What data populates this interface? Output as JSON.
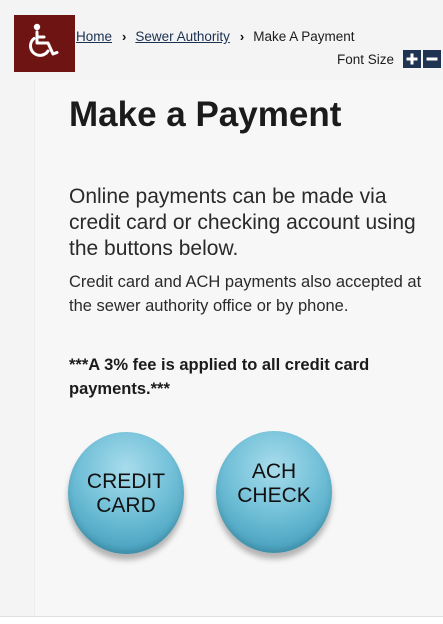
{
  "breadcrumb": {
    "home": "Home",
    "section": "Sewer Authority",
    "current": "Make A Payment",
    "separator": "›"
  },
  "font_size": {
    "label": "Font Size",
    "increase": "+",
    "decrease": "−"
  },
  "main": {
    "title": "Make a Payment",
    "lead": "Online payments can be made via credit card or checking account using the buttons below.",
    "body": "Credit card and ACH payments also accepted at the sewer authority office or by phone.",
    "fee_note": " ***A 3% fee is applied to all credit card payments.***"
  },
  "buttons": {
    "credit": "CREDIT\nCARD",
    "ach": "ACH\nCHECK"
  },
  "colors": {
    "accessibility_bg": "#6e1412",
    "font_button_bg": "#1e3452",
    "link": "#1a3150",
    "button_blue": "#72c0d8"
  },
  "icons": {
    "accessibility": "wheelchair-icon",
    "increase": "plus-icon",
    "decrease": "minus-icon"
  }
}
